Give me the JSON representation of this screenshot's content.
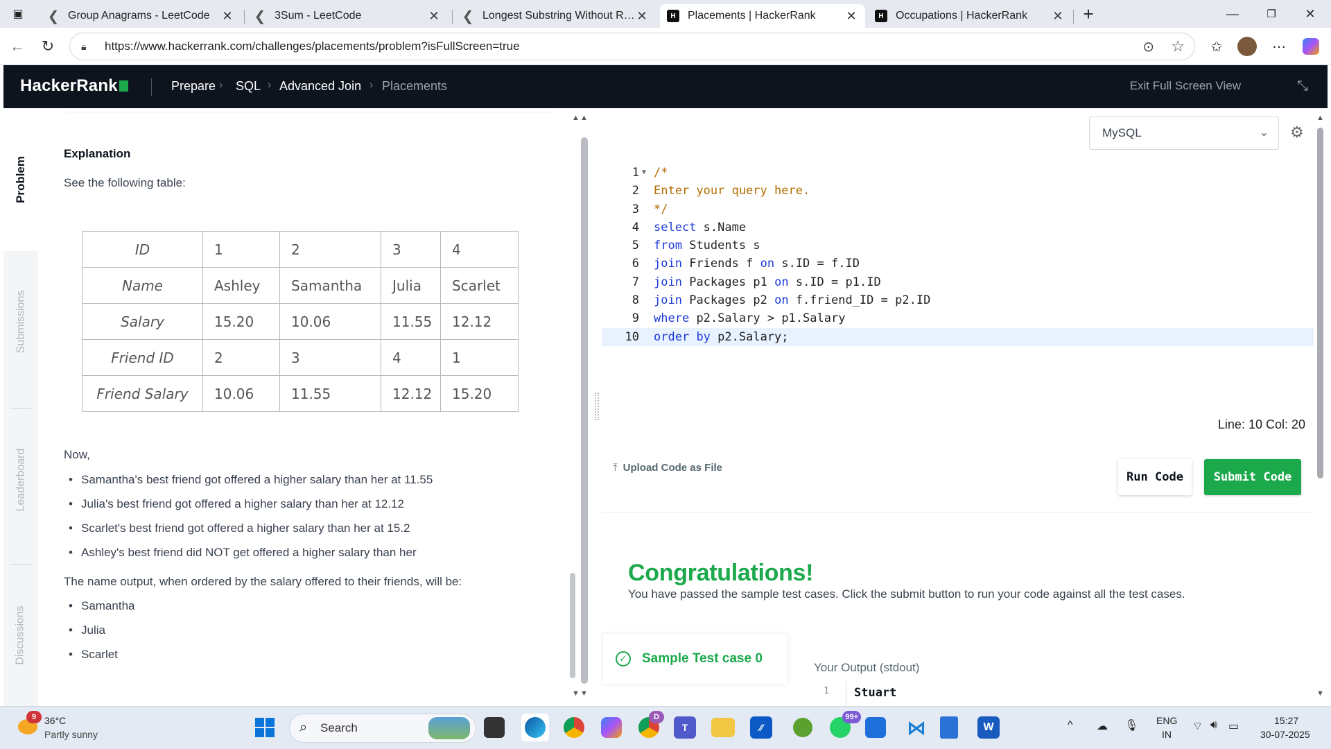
{
  "browser": {
    "tabs": [
      {
        "title": "Group Anagrams - LeetCode",
        "favicon": "leetcode-icon"
      },
      {
        "title": "3Sum - LeetCode",
        "favicon": "leetcode-icon"
      },
      {
        "title": "Longest Substring Without Repea",
        "favicon": "leetcode-icon"
      },
      {
        "title": "Placements | HackerRank",
        "favicon": "hackerrank-icon",
        "active": true
      },
      {
        "title": "Occupations | HackerRank",
        "favicon": "hackerrank-icon"
      }
    ],
    "url": "https://www.hackerrank.com/challenges/placements/problem?isFullScreen=true"
  },
  "header": {
    "logo": "HackerRank",
    "breadcrumbs": [
      "Prepare",
      "SQL",
      "Advanced Join",
      "Placements"
    ],
    "exit_fullscreen": "Exit Full Screen View"
  },
  "sidetabs": [
    "Problem",
    "Submissions",
    "Leaderboard",
    "Discussions"
  ],
  "problem": {
    "heading": "Explanation",
    "intro": "See the following table:",
    "table": [
      [
        "ID",
        "1",
        "2",
        "3",
        "4"
      ],
      [
        "Name",
        "Ashley",
        "Samantha",
        "Julia",
        "Scarlet"
      ],
      [
        "Salary",
        "15.20",
        "10.06",
        "11.55",
        "12.12"
      ],
      [
        "Friend ID",
        "2",
        "3",
        "4",
        "1"
      ],
      [
        "Friend Salary",
        "10.06",
        "11.55",
        "12.12",
        "15.20"
      ]
    ],
    "now": "Now,",
    "bullets": [
      "Samantha's best friend got offered a higher salary than her at 11.55",
      "Julia's best friend got offered a higher salary than her at 12.12",
      "Scarlet's best friend got offered a higher salary than her at 15.2",
      "Ashley's best friend did NOT get offered a higher salary than her"
    ],
    "output_intro": "The name output, when ordered by the salary offered to their friends, will be:",
    "names": [
      "Samantha",
      "Julia",
      "Scarlet"
    ]
  },
  "editor": {
    "language": "MySQL",
    "lines": [
      "/*",
      "Enter your query here.",
      "*/",
      "select s.Name",
      "from Students s",
      "join Friends f on s.ID = f.ID",
      "join Packages p1 on s.ID = p1.ID",
      "join Packages p2 on f.friend_ID = p2.ID",
      "where p2.Salary > p1.Salary",
      "order by p2.Salary;"
    ],
    "cursor": "Line: 10 Col: 20"
  },
  "actions": {
    "upload": "Upload Code as File",
    "run": "Run Code",
    "submit": "Submit Code"
  },
  "result": {
    "title": "Congratulations!",
    "message": "You have passed the sample test cases. Click the submit button to run your code against all the test cases.",
    "testcase": "Sample Test case 0",
    "output_label": "Your Output (stdout)",
    "output_line_no": "1",
    "output_first": "Stuart"
  },
  "taskbar": {
    "weather_temp": "36°C",
    "weather_desc": "Partly sunny",
    "weather_badge": "9",
    "search": "Search",
    "whatsapp_badge": "99+",
    "chrome_badge": "D",
    "lang_top": "ENG",
    "lang_bottom": "IN",
    "time": "15:27",
    "date": "30-07-2025"
  },
  "colors": {
    "hr_green": "#1ba94c",
    "hr_dark": "#0e141e"
  }
}
